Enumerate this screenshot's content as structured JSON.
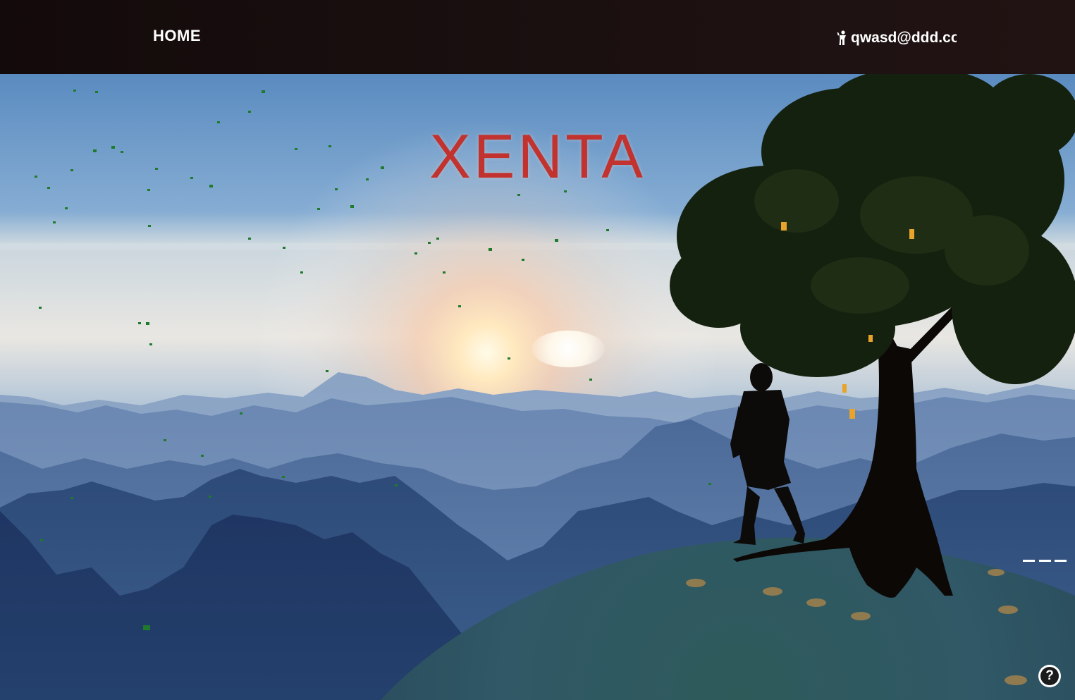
{
  "nav": {
    "home_label": "HOME",
    "user_email": "qwasd@ddd.com",
    "user_icon": "person-icon"
  },
  "hero": {
    "title": "XENTA",
    "title_color": "#c2332f"
  },
  "controls": {
    "help_label": "?",
    "help_icon": "help-circle-icon",
    "menu_icon": "dash-menu-icon"
  },
  "colors": {
    "topbar": "#1b1010",
    "sky_top": "#5b8cc1",
    "sun": "#fff4d6",
    "hill": "#2f5158"
  }
}
